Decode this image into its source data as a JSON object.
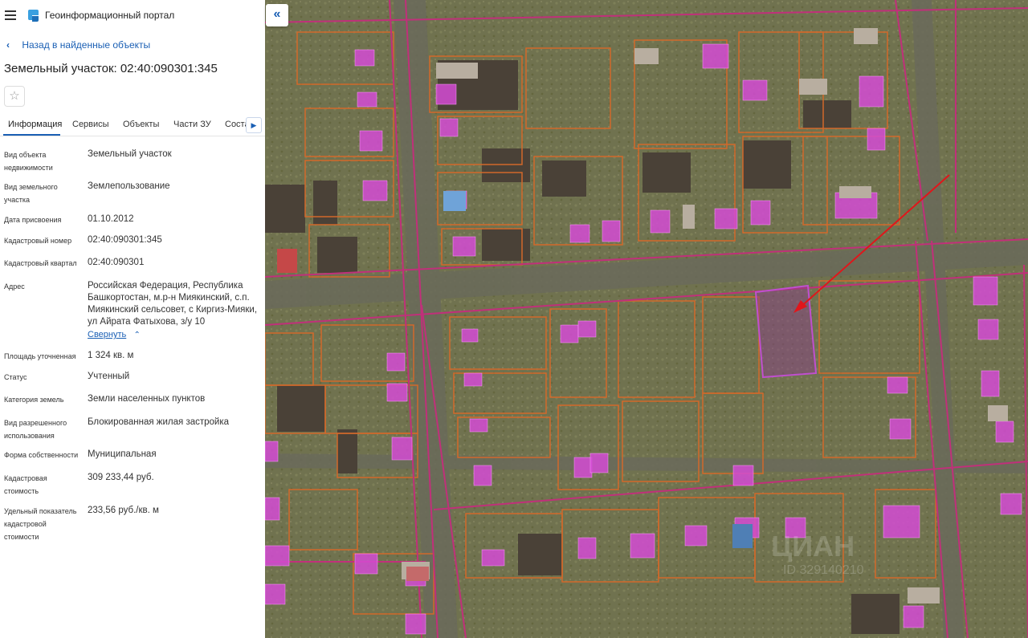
{
  "header": {
    "app_title": "Геоинформационный портал",
    "menu_icon": "menu-icon",
    "logo_icon": "portal-logo-icon"
  },
  "nav": {
    "back_label": "Назад в найденные объекты"
  },
  "object": {
    "title": "Земельный участок: 02:40:090301:345"
  },
  "tabs": [
    {
      "label": "Информация",
      "active": true
    },
    {
      "label": "Сервисы"
    },
    {
      "label": "Объекты"
    },
    {
      "label": "Части ЗУ"
    },
    {
      "label": "Соста"
    }
  ],
  "details": [
    {
      "label": "Вид объекта недвижимости",
      "value": "Земельный участок"
    },
    {
      "label": "Вид земельного участка",
      "value": "Землепользование"
    },
    {
      "label": "Дата присвоения",
      "value": "01.10.2012"
    },
    {
      "label": "Кадастровый номер",
      "value": "02:40:090301:345"
    },
    {
      "label": "Кадастровый квартал",
      "value": "02:40:090301"
    },
    {
      "label": "Адрес",
      "value": "Российская Федерация, Республика Башкортостан, м.р-н Миякинский, с.п. Миякинский сельсовет, с Киргиз-Мияки, ул Айрата Фатыхова, з/у 10"
    },
    {
      "label": "Площадь уточненная",
      "value": "1 324 кв. м"
    },
    {
      "label": "Статус",
      "value": "Учтенный"
    },
    {
      "label": "Категория земель",
      "value": "Земли населенных пунктов"
    },
    {
      "label": "Вид разрешенного использования",
      "value": "Блокированная жилая застройка"
    },
    {
      "label": "Форма собственности",
      "value": "Муниципальная"
    },
    {
      "label": "Кадастровая стоимость",
      "value": "309 233,44 руб."
    },
    {
      "label": "Удельный показатель кадастровой стоимости",
      "value": "233,56 руб./кв. м"
    }
  ],
  "address_toggle": "Свернуть",
  "map": {
    "watermark": "ЦИАН",
    "watermark_id": "ID 329140210",
    "colors": {
      "ground": "#6e7052",
      "parcel_orange": "#d2692a",
      "boundary_magenta": "#c0307a",
      "building_fill": "#d34bd3",
      "selected_parcel": "#8c3c8c",
      "arrow": "#e0161b"
    }
  }
}
